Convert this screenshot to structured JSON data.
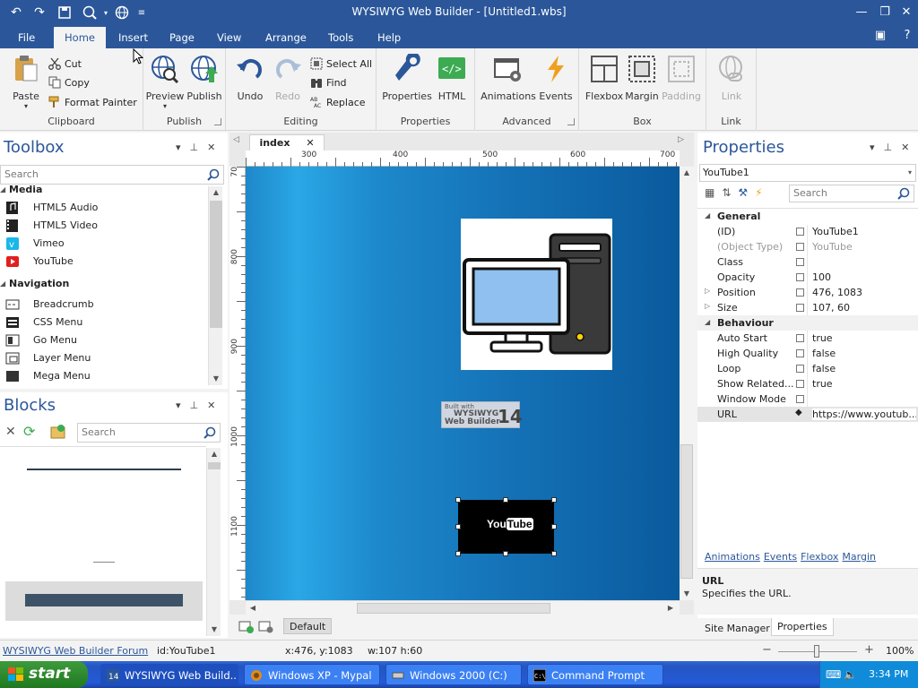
{
  "window": {
    "title": "WYSIWYG Web Builder - [Untitled1.wbs]"
  },
  "menu": {
    "tabs": [
      "File",
      "Home",
      "Insert",
      "Page",
      "View",
      "Arrange",
      "Tools",
      "Help"
    ]
  },
  "ribbon": {
    "clipboard": {
      "label": "Clipboard",
      "paste": "Paste",
      "cut": "Cut",
      "copy": "Copy",
      "format_painter": "Format Painter"
    },
    "publish": {
      "label": "Publish",
      "preview": "Preview",
      "publish": "Publish"
    },
    "editing": {
      "label": "Editing",
      "undo": "Undo",
      "redo": "Redo",
      "select_all": "Select All",
      "find": "Find",
      "replace": "Replace"
    },
    "properties": {
      "label": "Properties",
      "properties": "Properties",
      "html": "HTML"
    },
    "advanced": {
      "label": "Advanced",
      "animations": "Animations",
      "events": "Events"
    },
    "box": {
      "label": "Box",
      "flexbox": "Flexbox",
      "margin": "Margin",
      "padding": "Padding"
    },
    "link": {
      "label": "Link",
      "link": "Link"
    }
  },
  "toolbox": {
    "title": "Toolbox",
    "search_placeholder": "Search",
    "categories": [
      {
        "name": "Media",
        "items": [
          "HTML5 Audio",
          "HTML5 Video",
          "Vimeo",
          "YouTube"
        ]
      },
      {
        "name": "Navigation",
        "items": [
          "Breadcrumb",
          "CSS Menu",
          "Go Menu",
          "Layer Menu",
          "Mega Menu"
        ]
      }
    ]
  },
  "blocks": {
    "title": "Blocks",
    "search_placeholder": "Search"
  },
  "document": {
    "tab": "index",
    "ruler_h": [
      "300",
      "400",
      "500",
      "600",
      "700"
    ],
    "ruler_v": [
      "70",
      "800",
      "900",
      "1000",
      "1100"
    ],
    "badge_line1": "Built with",
    "badge_line2": "WYSIWYG",
    "badge_line3": "Web Builder",
    "badge_version": "14",
    "youtube_text": "You",
    "youtube_tube": "Tube",
    "layout_name": "Default"
  },
  "properties": {
    "title": "Properties",
    "object": "YouTube1",
    "search_placeholder": "Search",
    "groups": {
      "general": "General",
      "behaviour": "Behaviour"
    },
    "general_rows": [
      {
        "name": "(ID)",
        "value": "YouTube1"
      },
      {
        "name": "(Object Type)",
        "value": "YouTube"
      },
      {
        "name": "Class",
        "value": ""
      },
      {
        "name": "Opacity",
        "value": "100"
      },
      {
        "name": "Position",
        "value": "476, 1083"
      },
      {
        "name": "Size",
        "value": "107, 60"
      }
    ],
    "behaviour_rows": [
      {
        "name": "Auto Start",
        "value": "true"
      },
      {
        "name": "High Quality",
        "value": "false"
      },
      {
        "name": "Loop",
        "value": "false"
      },
      {
        "name": "Show Related...",
        "value": "true"
      },
      {
        "name": "Window Mode",
        "value": ""
      },
      {
        "name": "URL",
        "value": "https://www.youtub..."
      }
    ],
    "links": [
      "Animations",
      "Events",
      "Flexbox",
      "Margin"
    ],
    "desc_title": "URL",
    "desc_text": "Specifies the URL.",
    "bottom_tabs": [
      "Site Manager",
      "Properties"
    ]
  },
  "status": {
    "forum": "WYSIWYG Web Builder Forum",
    "id": "id:YouTube1",
    "xy": "x:476, y:1083",
    "wh": "w:107 h:60",
    "zoom": "100%"
  },
  "taskbar": {
    "start": "start",
    "buttons": [
      "WYSIWYG Web Build...",
      "Windows XP - Mypal",
      "Windows 2000 (C:)",
      "Command Prompt"
    ],
    "clock": "3:34 PM"
  }
}
